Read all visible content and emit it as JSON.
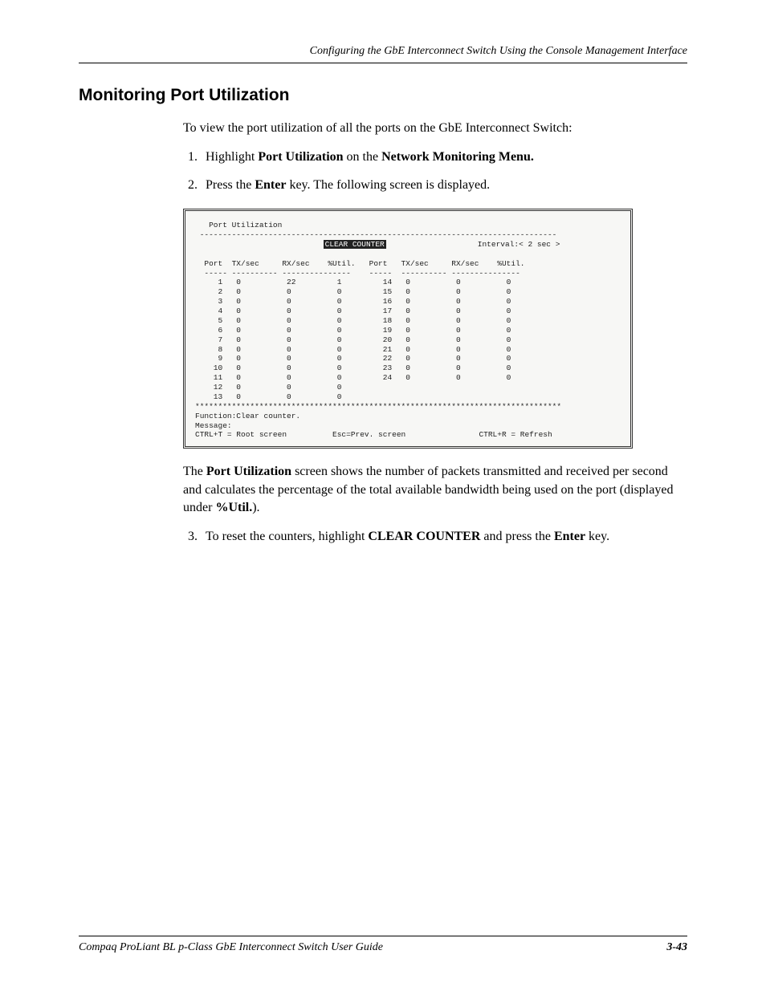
{
  "header": {
    "running": "Configuring the GbE Interconnect Switch Using the Console Management Interface"
  },
  "section": {
    "title": "Monitoring Port Utilization",
    "intro": "To view the port utilization of all the ports on the GbE Interconnect Switch:",
    "step1_prefix": "Highlight ",
    "step1_b1": "Port Utilization",
    "step1_mid": " on the ",
    "step1_b2": "Network Monitoring Menu.",
    "step2_prefix": "Press the ",
    "step2_b1": "Enter",
    "step2_suffix": " key. The following screen is displayed.",
    "post_prefix": "The ",
    "post_b1": "Port Utilization",
    "post_mid": " screen shows the number of packets transmitted and received per second and calculates the percentage of the total available bandwidth being used on the port (displayed under ",
    "post_b2": "%Util.",
    "post_suffix": ").",
    "step3_prefix": "To reset the counters, highlight ",
    "step3_b1": "CLEAR COUNTER",
    "step3_mid": " and press the ",
    "step3_b2": "Enter",
    "step3_suffix": " key."
  },
  "terminal": {
    "title": "Port Utilization",
    "clear_label": "CLEAR COUNTER",
    "interval_label": "Interval:< 2 sec >",
    "headers": [
      "Port",
      "TX/sec",
      "RX/sec",
      "%Util.",
      "Port",
      "TX/sec",
      "RX/sec",
      "%Util."
    ],
    "rows_left": [
      {
        "port": "1",
        "tx": "0",
        "rx": "22",
        "util": "1"
      },
      {
        "port": "2",
        "tx": "0",
        "rx": "0",
        "util": "0"
      },
      {
        "port": "3",
        "tx": "0",
        "rx": "0",
        "util": "0"
      },
      {
        "port": "4",
        "tx": "0",
        "rx": "0",
        "util": "0"
      },
      {
        "port": "5",
        "tx": "0",
        "rx": "0",
        "util": "0"
      },
      {
        "port": "6",
        "tx": "0",
        "rx": "0",
        "util": "0"
      },
      {
        "port": "7",
        "tx": "0",
        "rx": "0",
        "util": "0"
      },
      {
        "port": "8",
        "tx": "0",
        "rx": "0",
        "util": "0"
      },
      {
        "port": "9",
        "tx": "0",
        "rx": "0",
        "util": "0"
      },
      {
        "port": "10",
        "tx": "0",
        "rx": "0",
        "util": "0"
      },
      {
        "port": "11",
        "tx": "0",
        "rx": "0",
        "util": "0"
      },
      {
        "port": "12",
        "tx": "0",
        "rx": "0",
        "util": "0"
      },
      {
        "port": "13",
        "tx": "0",
        "rx": "0",
        "util": "0"
      }
    ],
    "rows_right": [
      {
        "port": "14",
        "tx": "0",
        "rx": "0",
        "util": "0"
      },
      {
        "port": "15",
        "tx": "0",
        "rx": "0",
        "util": "0"
      },
      {
        "port": "16",
        "tx": "0",
        "rx": "0",
        "util": "0"
      },
      {
        "port": "17",
        "tx": "0",
        "rx": "0",
        "util": "0"
      },
      {
        "port": "18",
        "tx": "0",
        "rx": "0",
        "util": "0"
      },
      {
        "port": "19",
        "tx": "0",
        "rx": "0",
        "util": "0"
      },
      {
        "port": "20",
        "tx": "0",
        "rx": "0",
        "util": "0"
      },
      {
        "port": "21",
        "tx": "0",
        "rx": "0",
        "util": "0"
      },
      {
        "port": "22",
        "tx": "0",
        "rx": "0",
        "util": "0"
      },
      {
        "port": "23",
        "tx": "0",
        "rx": "0",
        "util": "0"
      },
      {
        "port": "24",
        "tx": "0",
        "rx": "0",
        "util": "0"
      }
    ],
    "function_line": "Function:Clear counter.",
    "message_line": "Message:",
    "help_left": "CTRL+T = Root screen",
    "help_mid": "Esc=Prev. screen",
    "help_right": "CTRL+R = Refresh"
  },
  "footer": {
    "guide": "Compaq ProLiant BL p-Class GbE Interconnect Switch User Guide",
    "page": "3-43"
  }
}
